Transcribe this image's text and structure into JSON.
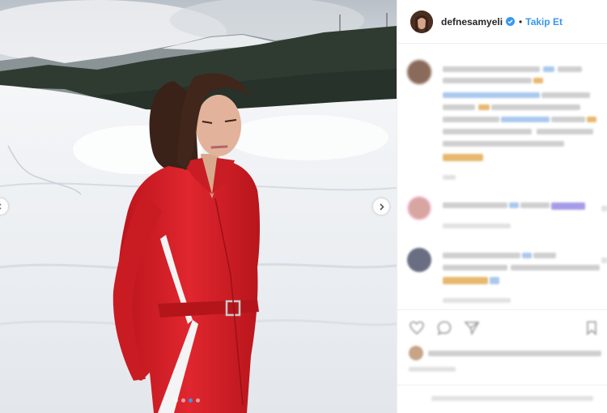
{
  "post": {
    "username": "defnesamyeli",
    "separator": "•",
    "follow_label": "Takip Et",
    "verified": true,
    "carousel": {
      "total_slides": 4,
      "active_slide": 3
    }
  },
  "colors": {
    "accent": "#3897f0",
    "jumpsuit": "#d8222a",
    "snow": "#f2f4f6",
    "forest": "#2c3a2e"
  },
  "icons": {
    "verified": "verified-badge-icon",
    "next": "chevron-right-icon",
    "prev": "chevron-left-icon",
    "like": "heart-icon",
    "comment": "comment-icon",
    "share": "share-icon",
    "save": "bookmark-icon"
  },
  "comments": [
    {
      "id": "comment-1",
      "text_redacted": true
    },
    {
      "id": "comment-2",
      "text_redacted": true
    },
    {
      "id": "comment-3",
      "text_redacted": true
    }
  ]
}
